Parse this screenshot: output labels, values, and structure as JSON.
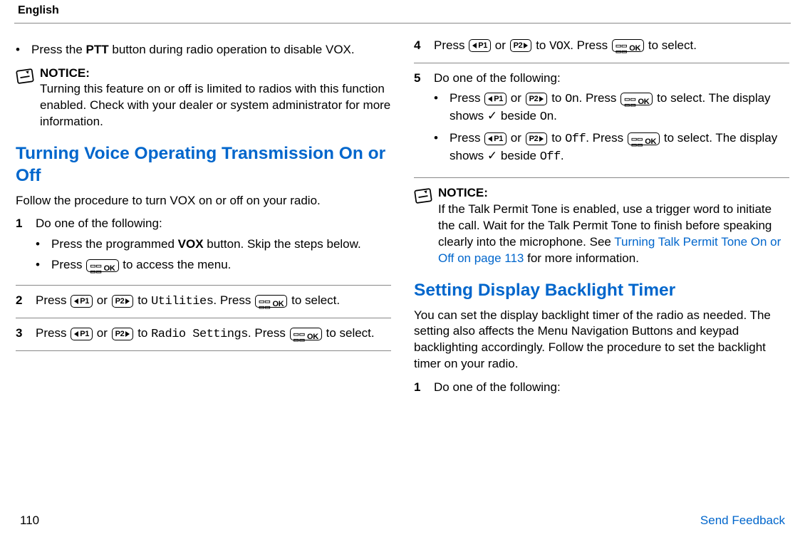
{
  "header": {
    "language": "English"
  },
  "left": {
    "intro_bullet": {
      "pre": "Press the ",
      "button_name": "PTT",
      "post": " button during radio operation to disable VOX."
    },
    "notice": {
      "title": "NOTICE:",
      "text": "Turning this feature on or off is limited to radios with this function enabled. Check with your dealer or system administrator for more information."
    },
    "h2": "Turning Voice Operating Transmission On or Off",
    "intro": "Follow the procedure to turn VOX on or off on your radio.",
    "step1": {
      "num": "1",
      "lead": "Do one of the following:",
      "b1_pre": "Press the programmed ",
      "b1_bold": "VOX",
      "b1_post": " button. Skip the steps below.",
      "b2_pre": "Press ",
      "b2_post": " to access the menu."
    },
    "step2": {
      "num": "2",
      "pre": "Press ",
      "or": " or ",
      "to": " to ",
      "target": "Utilities",
      "post1": ". Press ",
      "post2": " to select."
    },
    "step3": {
      "num": "3",
      "pre": "Press ",
      "or": " or ",
      "to": " to ",
      "target": "Radio Settings",
      "post1": ". Press ",
      "post2": " to select."
    }
  },
  "right": {
    "step4": {
      "num": "4",
      "pre": "Press ",
      "or": " or ",
      "to": " to ",
      "target": "VOX",
      "post1": ". Press ",
      "post2": " to select."
    },
    "step5": {
      "num": "5",
      "lead": "Do one of the following:",
      "b1_pre": "Press ",
      "b1_or": " or ",
      "b1_to": " to ",
      "b1_target": "On",
      "b1_post1": ". Press ",
      "b1_post2": " to select. The display shows ",
      "b1_check": "✓",
      "b1_post3": " beside ",
      "b1_target2": "On",
      "b1_post4": ".",
      "b2_pre": "Press ",
      "b2_or": " or ",
      "b2_to": " to ",
      "b2_target": "Off",
      "b2_post1": ". Press ",
      "b2_post2": " to select. The display shows ",
      "b2_check": "✓",
      "b2_post3": " beside ",
      "b2_target2": "Off",
      "b2_post4": "."
    },
    "notice": {
      "title": "NOTICE:",
      "text_pre": "If the Talk Permit Tone is enabled, use a trigger word to initiate the call. Wait for the Talk Permit Tone to finish before speaking clearly into the microphone. See ",
      "link": "Turning Talk Permit Tone On or Off on page 113",
      "text_post": " for more information."
    },
    "h2b": "Setting Display Backlight Timer",
    "intro2": "You can set the display backlight timer of the radio as needed. The setting also affects the Menu Navigation Buttons and keypad backlighting accordingly. Follow the procedure to set the backlight timer on your radio.",
    "step1b": {
      "num": "1",
      "lead": "Do one of the following:"
    }
  },
  "footer": {
    "page": "110",
    "feedback": "Send Feedback"
  }
}
